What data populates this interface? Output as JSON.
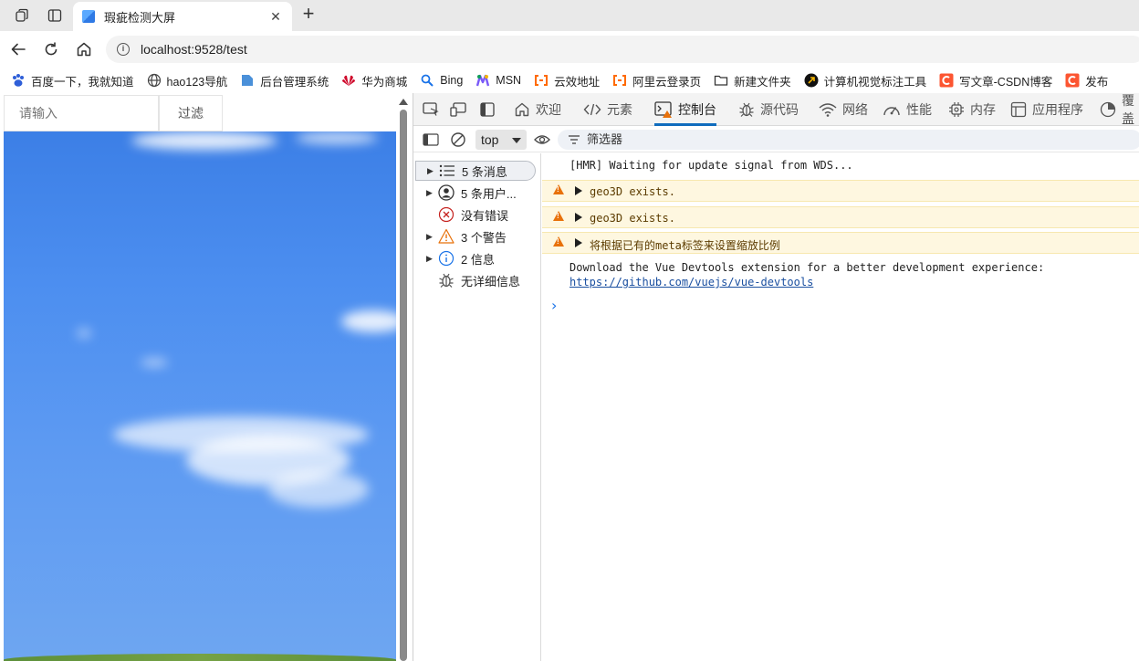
{
  "browser": {
    "tab": {
      "title": "瑕疵检测大屏",
      "close": "✕"
    },
    "new_tab": "+",
    "address": {
      "url": "localhost:9528/test",
      "info": "i"
    }
  },
  "bookmarks": [
    {
      "label": "百度一下，我就知道",
      "icon": "baidu-paw-icon",
      "color": "#2f5fd8"
    },
    {
      "label": "hao123导航",
      "icon": "globe-icon",
      "color": "#444444"
    },
    {
      "label": "后台管理系统",
      "icon": "page-icon",
      "color": "#4a90d9"
    },
    {
      "label": "华为商城",
      "icon": "huawei-icon",
      "color": "#cf0a2c"
    },
    {
      "label": "Bing",
      "icon": "bing-search-icon",
      "color": "#1a73e8"
    },
    {
      "label": "MSN",
      "icon": "msn-icon",
      "color": "#7a5af8"
    },
    {
      "label": "云效地址",
      "icon": "aliyun-icon",
      "color": "#ff6a00"
    },
    {
      "label": "阿里云登录页",
      "icon": "aliyun-icon",
      "color": "#ff6a00"
    },
    {
      "label": "新建文件夹",
      "icon": "folder-icon",
      "color": "#333333"
    },
    {
      "label": "计算机视觉标注工具",
      "icon": "arrow-circle-icon",
      "color": "#111111"
    },
    {
      "label": "写文章-CSDN博客",
      "icon": "csdn-icon",
      "color": "#fc5531"
    },
    {
      "label": "发布",
      "icon": "csdn-icon",
      "color": "#fc5531"
    }
  ],
  "page": {
    "filter_placeholder": "请输入",
    "filter_button": "过滤"
  },
  "devtools": {
    "tabs": [
      {
        "label": "欢迎",
        "icon": "home-icon"
      },
      {
        "label": "元素",
        "icon": "code-icon"
      },
      {
        "label": "控制台",
        "icon": "console-icon",
        "active": true
      },
      {
        "label": "源代码",
        "icon": "bug-icon"
      },
      {
        "label": "网络",
        "icon": "wifi-icon"
      },
      {
        "label": "性能",
        "icon": "gauge-icon"
      },
      {
        "label": "内存",
        "icon": "chip-icon"
      },
      {
        "label": "应用程序",
        "icon": "app-icon"
      },
      {
        "label": "覆盖",
        "icon": "coverage-icon"
      }
    ],
    "toolbar": {
      "context": "top",
      "filter_label": "筛选器"
    },
    "sidebar": [
      {
        "label": "5 条消息",
        "icon": "list-icon",
        "expandable": true,
        "selected": true
      },
      {
        "label": "5 条用户...",
        "icon": "user-icon",
        "expandable": true
      },
      {
        "label": "没有错误",
        "icon": "error-icon",
        "expandable": false
      },
      {
        "label": "3 个警告",
        "icon": "warning-icon",
        "expandable": true
      },
      {
        "label": "2 信息",
        "icon": "info-icon",
        "expandable": true
      },
      {
        "label": "无详细信息",
        "icon": "bug-icon",
        "expandable": false
      }
    ],
    "console": {
      "lines": [
        {
          "level": "log",
          "text": "[HMR] Waiting for update signal from WDS..."
        },
        {
          "level": "warn",
          "text": "geo3D exists."
        },
        {
          "level": "warn",
          "text": "geo3D exists."
        },
        {
          "level": "warn",
          "text": "将根据已有的meta标签来设置缩放比例"
        },
        {
          "level": "log",
          "text": "Download the Vue Devtools extension for a better development experience:",
          "link": "https://github.com/vuejs/vue-devtools"
        }
      ],
      "prompt": "›"
    }
  }
}
